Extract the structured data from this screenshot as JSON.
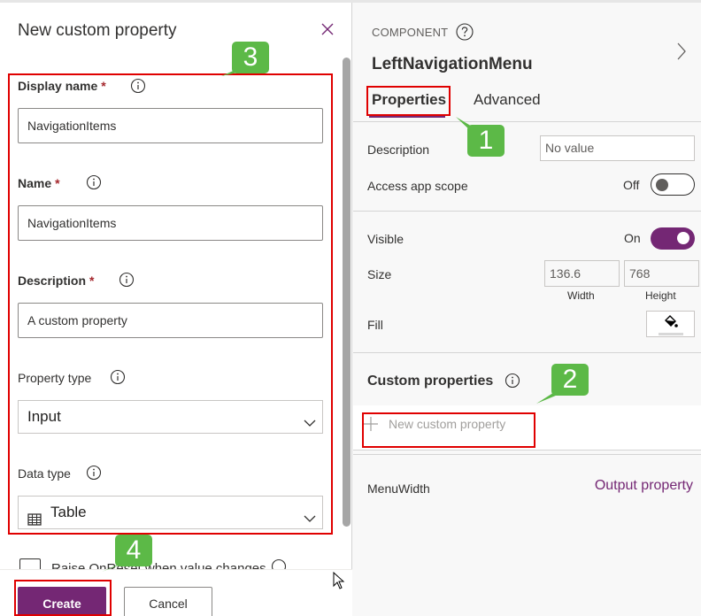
{
  "dialog": {
    "title": "New custom property",
    "fields": {
      "display_name": {
        "label": "Display name",
        "required": "*",
        "value": "NavigationItems"
      },
      "name": {
        "label": "Name",
        "required": "*",
        "value": "NavigationItems"
      },
      "description": {
        "label": "Description",
        "required": "*",
        "value": "A custom property"
      },
      "property_type": {
        "label": "Property type",
        "selected": "Input"
      },
      "data_type": {
        "label": "Data type",
        "selected": "Table",
        "icon": "table-icon"
      }
    },
    "checkbox": {
      "label": "Raise OnReset when value changes",
      "checked": false
    },
    "buttons": {
      "create": "Create",
      "cancel": "Cancel"
    }
  },
  "panel": {
    "component_label": "COMPONENT",
    "component_name": "LeftNavigationMenu",
    "tabs": [
      {
        "label": "Properties",
        "active": true
      },
      {
        "label": "Advanced",
        "active": false
      }
    ],
    "description": {
      "label": "Description",
      "placeholder": "No value"
    },
    "access_app_scope": {
      "label": "Access app scope",
      "state": "Off"
    },
    "visible": {
      "label": "Visible",
      "state": "On"
    },
    "size": {
      "label": "Size",
      "width": "136.6",
      "height": "768",
      "width_label": "Width",
      "height_label": "Height"
    },
    "fill": {
      "label": "Fill"
    },
    "custom_properties": {
      "heading": "Custom properties",
      "new_label": "New custom property",
      "items": [
        {
          "name": "MenuWidth",
          "type": "Output property"
        }
      ]
    }
  },
  "annotations": [
    "1",
    "2",
    "3",
    "4"
  ],
  "colors": {
    "accent": "#742774",
    "annotation_box": "#e00000",
    "annotation_badge": "#5cb947"
  }
}
